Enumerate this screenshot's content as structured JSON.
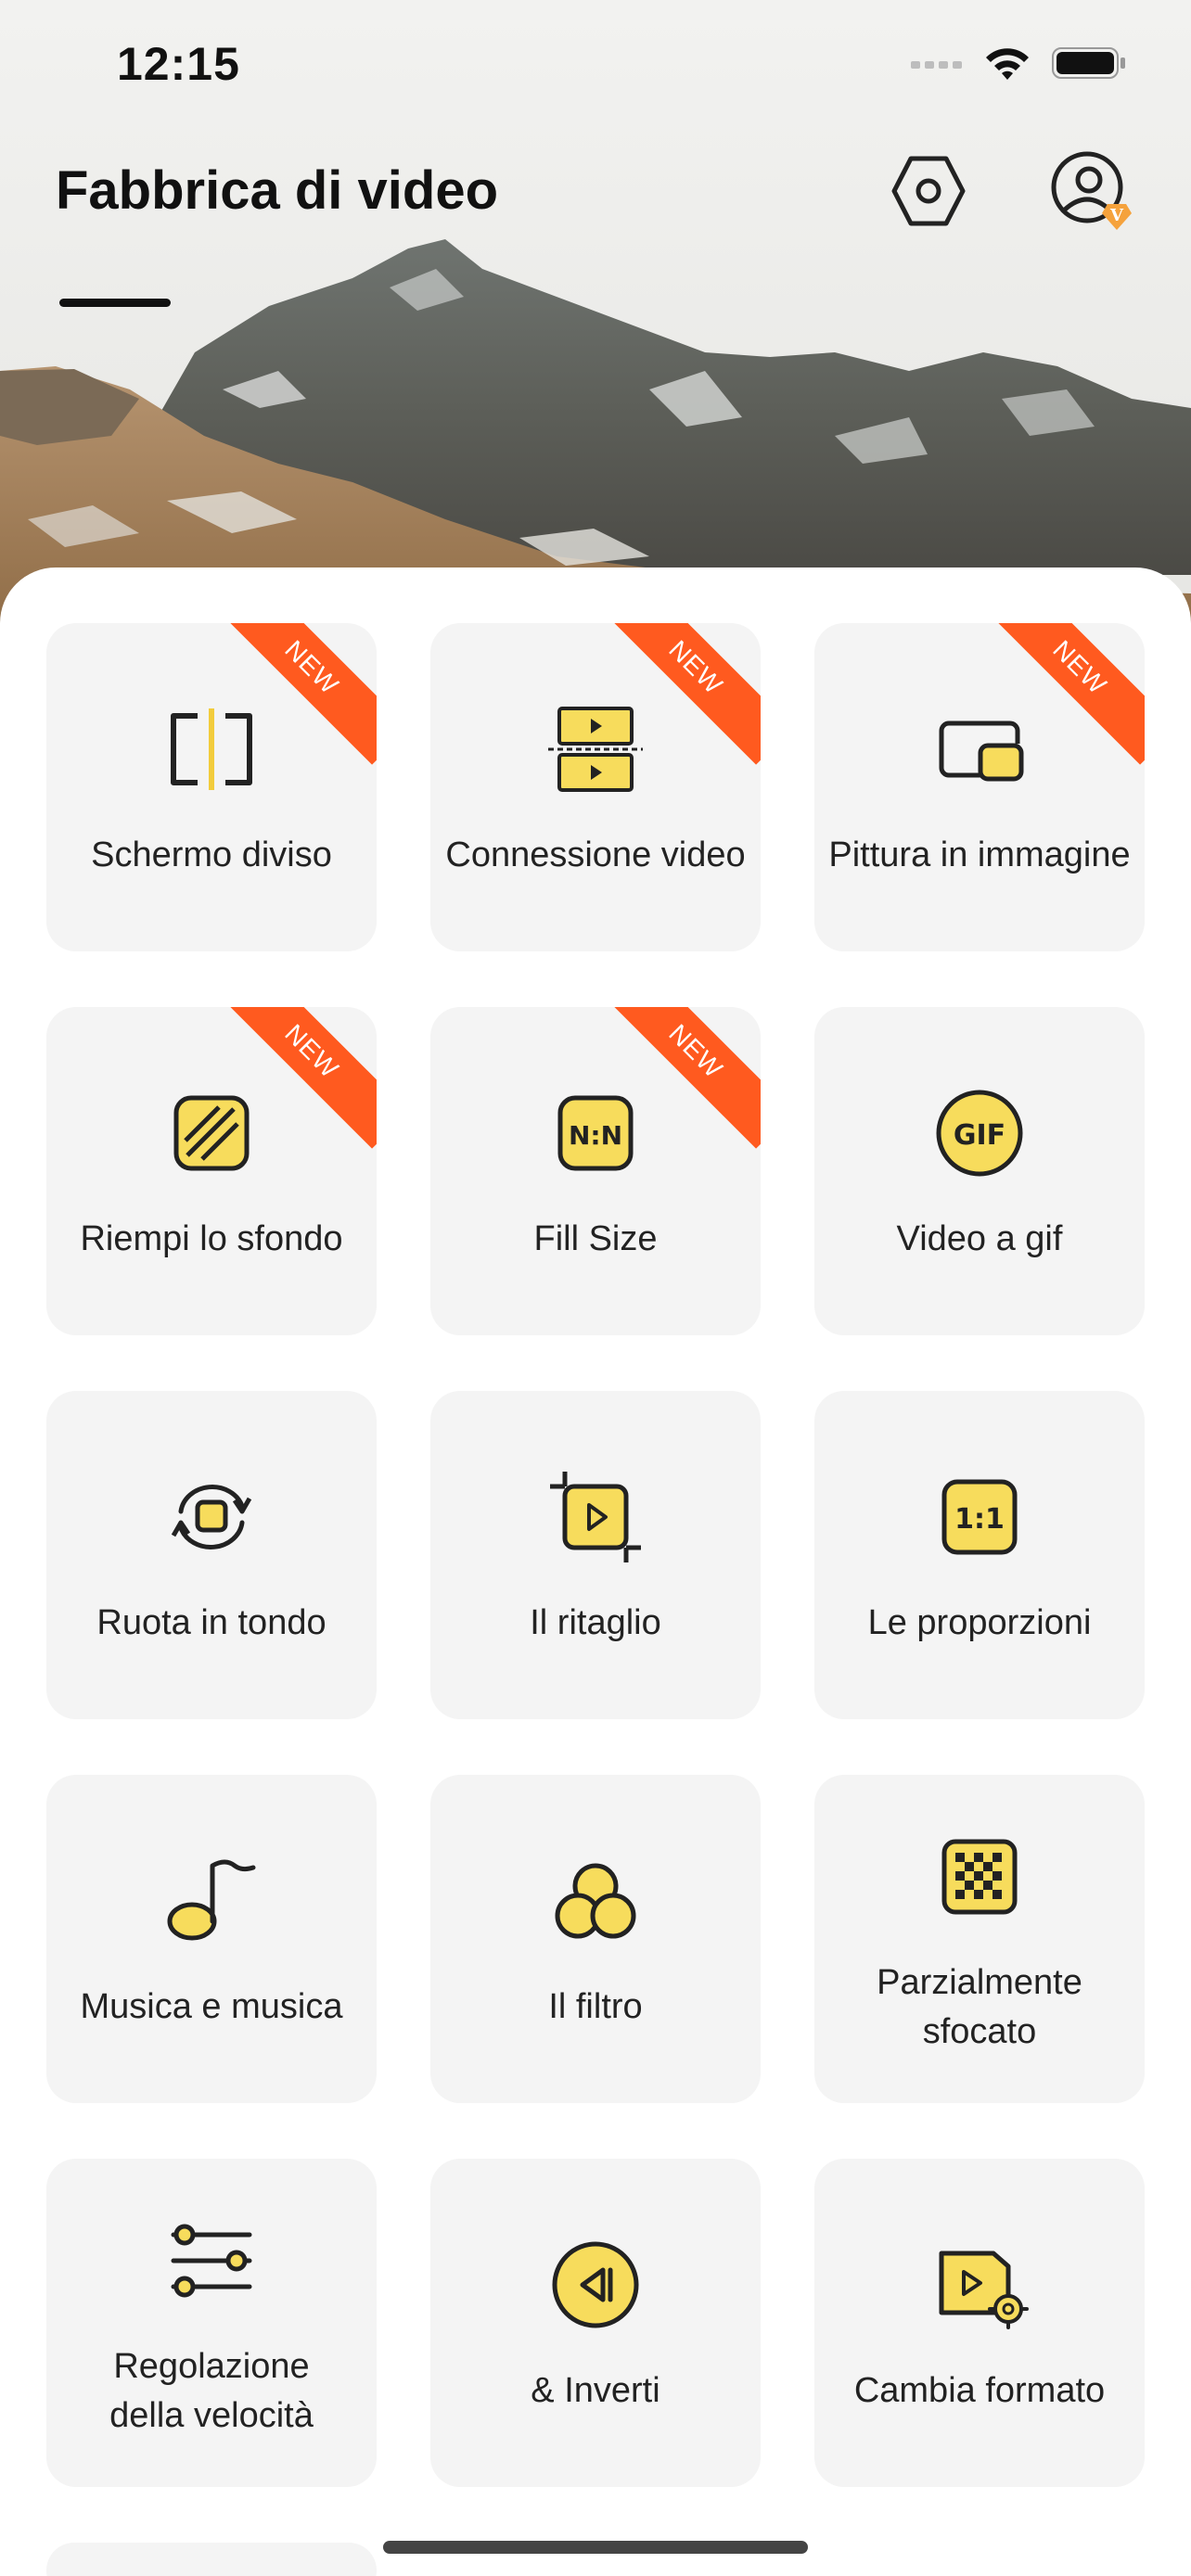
{
  "status_bar": {
    "time": "12:15"
  },
  "header": {
    "title": "Fabbrica di video",
    "vip_badge": "V"
  },
  "colors": {
    "accent": "#f7dc5c",
    "ribbon": "#ff5a1f",
    "tile_bg": "#f4f4f4"
  },
  "tools": [
    {
      "label": "Schermo diviso",
      "icon": "split-screen-icon",
      "badge": "NEW"
    },
    {
      "label": "Connessione video",
      "icon": "video-connect-icon",
      "badge": "NEW"
    },
    {
      "label": "Pittura in immagine",
      "icon": "picture-in-picture-icon",
      "badge": "NEW"
    },
    {
      "label": "Riempi lo sfondo",
      "icon": "fill-background-icon",
      "badge": "NEW"
    },
    {
      "label": "Fill Size",
      "icon": "fill-size-icon",
      "icon_text": "N:N",
      "badge": "NEW"
    },
    {
      "label": "Video a gif",
      "icon": "gif-icon",
      "icon_text": "GIF"
    },
    {
      "label": "Ruota in tondo",
      "icon": "rotate-icon"
    },
    {
      "label": "Il ritaglio",
      "icon": "crop-icon"
    },
    {
      "label": "Le proporzioni",
      "icon": "aspect-ratio-icon",
      "icon_text": "1:1"
    },
    {
      "label": "Musica e musica",
      "icon": "music-note-icon"
    },
    {
      "label": "Il filtro",
      "icon": "filter-icon"
    },
    {
      "label": "Parzialmente sfocato",
      "icon": "mosaic-icon"
    },
    {
      "label": "Regolazione della velocità",
      "icon": "speed-sliders-icon"
    },
    {
      "label": "& Inverti",
      "icon": "reverse-icon"
    },
    {
      "label": "Cambia formato",
      "icon": "format-change-icon"
    }
  ]
}
